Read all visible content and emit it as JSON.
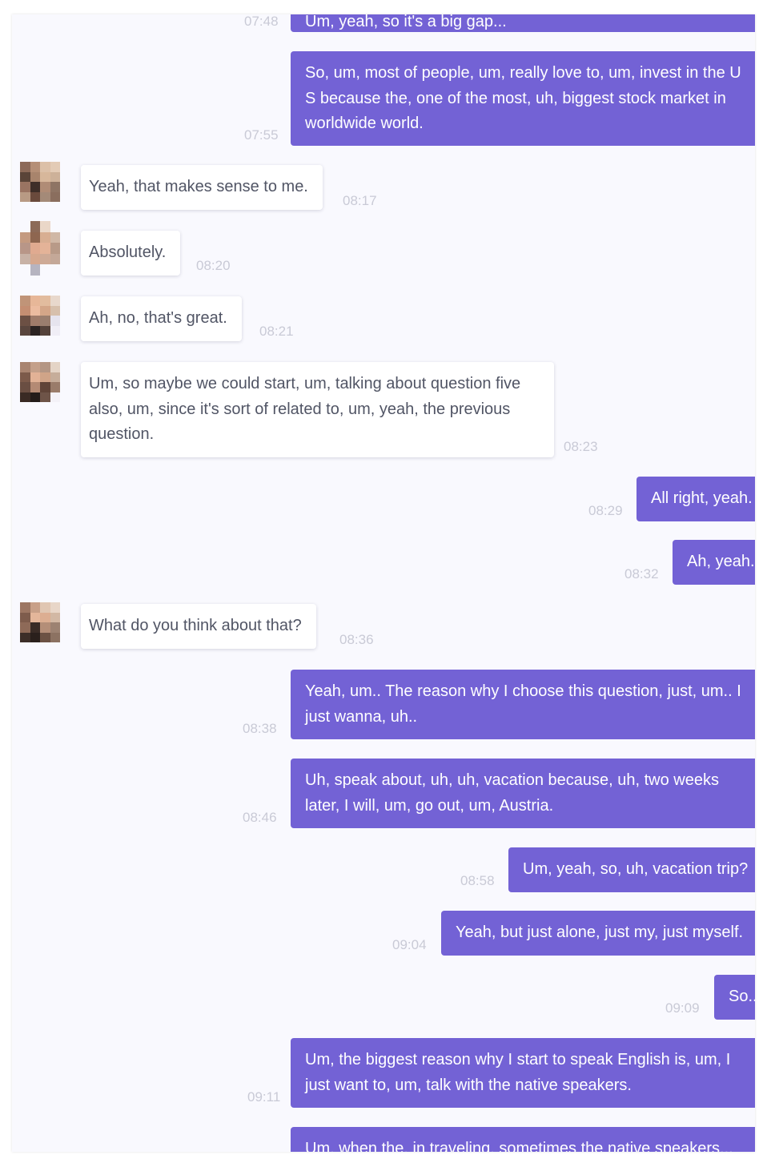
{
  "colors": {
    "outgoing_bubble": "#7362d5",
    "incoming_bubble": "#ffffff",
    "incoming_text": "#515565",
    "timestamp": "#c9cad6",
    "background": "#f9f9fe"
  },
  "messages": [
    {
      "id": "m0",
      "dir": "out",
      "text": "Um, yeah, so it's a big gap...",
      "time": "07:48"
    },
    {
      "id": "m1",
      "dir": "out",
      "text": "So, um, most of people, um, really love to, um, invest in the U S because the, one of the most, uh, biggest stock market in worldwide world.",
      "time": "07:55"
    },
    {
      "id": "m2",
      "dir": "in",
      "text": "Yeah, that makes sense to me.",
      "time": "08:17",
      "avatar_icon": "pixelated-avatar-icon"
    },
    {
      "id": "m3",
      "dir": "in",
      "text": "Absolutely.",
      "time": "08:20",
      "avatar_icon": "pixelated-avatar-icon"
    },
    {
      "id": "m4",
      "dir": "in",
      "text": "Ah, no, that's great.",
      "time": "08:21",
      "avatar_icon": "pixelated-avatar-icon"
    },
    {
      "id": "m5",
      "dir": "in",
      "text": "Um, so maybe we could start, um, talking about question five also, um, since it's sort of related to, um, yeah, the previous question.",
      "time": "08:23",
      "avatar_icon": "pixelated-avatar-icon"
    },
    {
      "id": "m6",
      "dir": "out",
      "text": "All right, yeah.",
      "time": "08:29"
    },
    {
      "id": "m7",
      "dir": "out",
      "text": "Ah, yeah.",
      "time": "08:32"
    },
    {
      "id": "m8",
      "dir": "in",
      "text": "What do you think about that?",
      "time": "08:36",
      "avatar_icon": "pixelated-avatar-icon"
    },
    {
      "id": "m9",
      "dir": "out",
      "text": "Yeah, um.. The reason why I choose this question, just, um.. I just wanna, uh..",
      "time": "08:38"
    },
    {
      "id": "m10",
      "dir": "out",
      "text": "Uh, speak about, uh, uh, vacation because, uh, two weeks later, I will, um, go out, um, Austria.",
      "time": "08:46"
    },
    {
      "id": "m11",
      "dir": "out",
      "text": "Um, yeah, so, uh, vacation trip?",
      "time": "08:58"
    },
    {
      "id": "m12",
      "dir": "out",
      "text": "Yeah, but just alone, just my, just myself.",
      "time": "09:04"
    },
    {
      "id": "m13",
      "dir": "out",
      "text": "So..",
      "time": "09:09"
    },
    {
      "id": "m14",
      "dir": "out",
      "text": "Um, the biggest reason why I start to speak English is, um, I just want to, um, talk with the native speakers.",
      "time": "09:11"
    },
    {
      "id": "m15",
      "dir": "out",
      "text": "Um, when the, in traveling, sometimes the native speakers...",
      "time": ""
    }
  ]
}
